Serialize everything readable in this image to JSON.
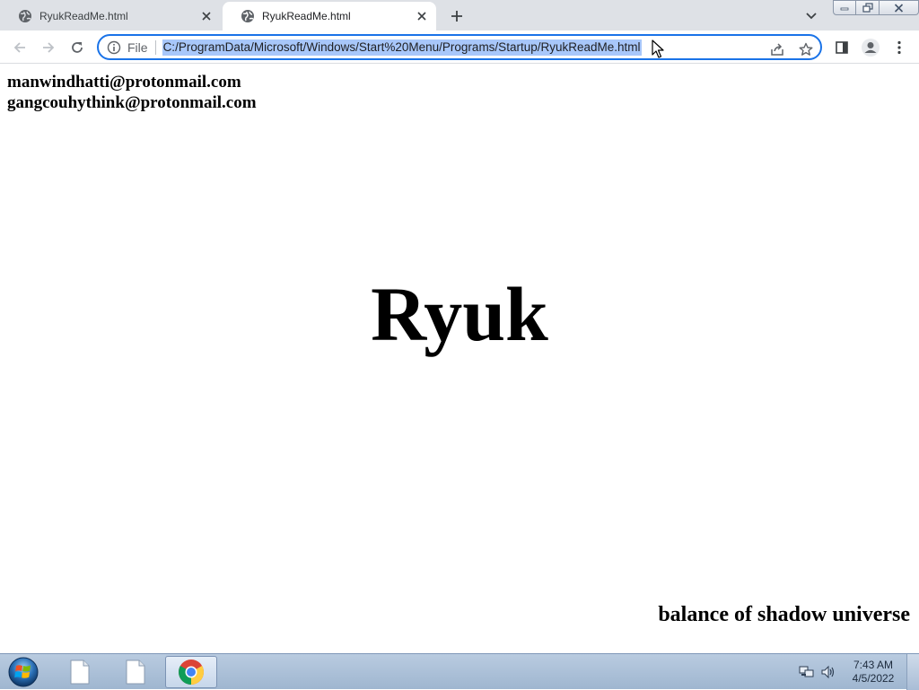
{
  "tabs": [
    {
      "title": "RyukReadMe.html",
      "active": false
    },
    {
      "title": "RyukReadMe.html",
      "active": true
    }
  ],
  "toolbar": {
    "omnibox": {
      "scheme_label": "File",
      "url": "C:/ProgramData/Microsoft/Windows/Start%20Menu/Programs/Startup/RyukReadMe.html",
      "selected": true
    }
  },
  "page": {
    "emails": [
      "manwindhatti@protonmail.com",
      "gangcouhythink@protonmail.com"
    ],
    "headline": "Ryuk",
    "footer": "balance of shadow universe"
  },
  "taskbar": {
    "items": [
      "file-icon",
      "file-icon",
      "chrome-icon"
    ],
    "active_item": "chrome-icon",
    "clock": {
      "time": "7:43 AM",
      "date": "4/5/2022"
    }
  },
  "colors": {
    "tabstrip_bg": "#dee1e6",
    "omnibox_focus": "#1a73e8",
    "url_selection": "#a8c7fa",
    "taskbar_bg": "#a9bfd8"
  }
}
